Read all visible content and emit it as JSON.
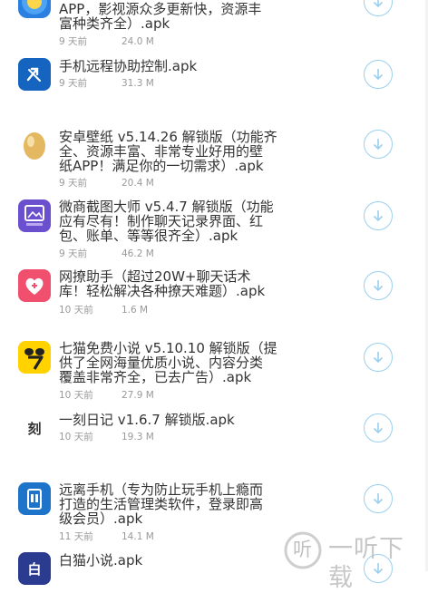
{
  "files": [
    {
      "name": "APP，影视源众多更新快，资源丰\n富种类齐全）.apk",
      "date": "9 天前",
      "size": "24.0 M",
      "icon": "video-app-icon"
    },
    {
      "name": "手机远程协助控制.apk",
      "date": "9 天前",
      "size": "31.3 M",
      "icon": "remote-control-app-icon"
    },
    {
      "name": "安卓壁纸 v5.14.26 解锁版（功能齐\n全、资源丰富、非常专业好用的壁\n纸APP！满足你的一切需求）.apk",
      "date": "9 天前",
      "size": "20.4 M",
      "icon": "egg-app-icon"
    },
    {
      "name": "微商截图大师 v5.4.7 解锁版（功能\n应有尽有！制作聊天记录界面、红\n包、账单、等等很齐全）.apk",
      "date": "9 天前",
      "size": "46.2 M",
      "icon": "screenshot-master-app-icon"
    },
    {
      "name": "网撩助手（超过20W+聊天话术\n库！轻松解决各种撩天难题）.apk",
      "date": "10 天前",
      "size": "1.6 M",
      "icon": "heart-chat-app-icon"
    },
    {
      "name": "七猫免费小说 v5.10.10 解锁版（提\n供了全网海量优质小说、内容分类\n覆盖非常齐全，已去广告）.apk",
      "date": "10 天前",
      "size": "27.9 M",
      "icon": "qimao-novel-app-icon"
    },
    {
      "name": "一刻日记 v1.6.7 解锁版.apk",
      "date": "10 天前",
      "size": "19.3 M",
      "icon": "yike-diary-app-icon"
    },
    {
      "name": "远离手机（专为防止玩手机上瘾而\n打造的生活管理类软件，登录即高\n级会员）.apk",
      "date": "11 天前",
      "size": "14.1 M",
      "icon": "phone-lock-app-icon"
    },
    {
      "name": "白猫小说.apk",
      "date": "",
      "size": "",
      "icon": "baimao-novel-app-icon"
    }
  ],
  "icon_text": {
    "yike": "刻",
    "baimao": "白"
  },
  "watermark": {
    "text": "一听下载",
    "logo_glyph": "听"
  },
  "colors": {
    "download_ring": "#9ad0ee",
    "meta_text": "#999999",
    "title_text": "#333333"
  }
}
